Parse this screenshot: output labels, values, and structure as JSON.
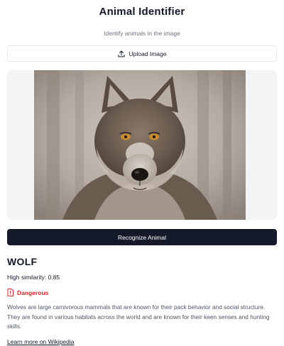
{
  "header": {
    "title": "Animal Identifier",
    "subtitle": "Identify animals in the image"
  },
  "upload": {
    "label": "Upload Image",
    "icon": "upload-icon"
  },
  "image": {
    "subject": "wolf-photo"
  },
  "recognize": {
    "label": "Recognize Animal"
  },
  "result": {
    "name": "WOLF",
    "similarity": "High similarity: 0.85",
    "danger_label": "Dangerous",
    "danger_icon": "warning-file-icon",
    "description": "Wolves are large carnivorous mammals that are known for their pack behavior and social structure. They are found in various habitats across the world and are known for their keen senses and hunting skills.",
    "link_text": "Learn more on Wikipedia"
  },
  "colors": {
    "primary_button": "#141a2a",
    "danger": "#dc2626",
    "panel_bg": "#f3f4f6",
    "muted_text": "#6b7280"
  }
}
